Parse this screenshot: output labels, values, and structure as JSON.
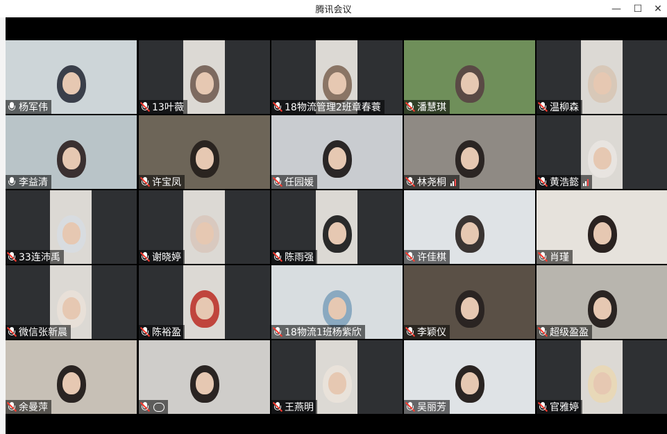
{
  "window": {
    "title": "腾讯会议",
    "controls": {
      "minimize": "—",
      "maximize": "☐",
      "close": "✕"
    }
  },
  "participants": [
    {
      "name": "杨军伟",
      "muted": false,
      "signal": false,
      "chat": false,
      "bg": "#cdd5d8",
      "person": "#3a3f4a"
    },
    {
      "name": "13叶薇",
      "muted": true,
      "signal": false,
      "chat": false,
      "bg": "#2e3033",
      "person": "#7d6a60"
    },
    {
      "name": "18物流管理2班章春蓑",
      "muted": true,
      "signal": false,
      "chat": false,
      "bg": "#2e3033",
      "person": "#8a7565"
    },
    {
      "name": "潘慧琪",
      "muted": true,
      "signal": false,
      "chat": false,
      "bg": "#6f8f5a",
      "person": "#5a4a45"
    },
    {
      "name": "温柳森",
      "muted": true,
      "signal": false,
      "chat": false,
      "bg": "#2e3033",
      "person": "#d8c8b8"
    },
    {
      "name": "李益清",
      "muted": false,
      "signal": false,
      "chat": false,
      "bg": "#b9c4c8",
      "person": "#3a3030"
    },
    {
      "name": "许宝凤",
      "muted": true,
      "signal": false,
      "chat": false,
      "bg": "#6d6558",
      "person": "#2a2420"
    },
    {
      "name": "任园媛",
      "muted": true,
      "signal": false,
      "chat": false,
      "bg": "#c9ccd0",
      "person": "#2a2626"
    },
    {
      "name": "林尧桐",
      "muted": true,
      "signal": true,
      "chat": false,
      "bg": "#8f8a84",
      "person": "#2b2523"
    },
    {
      "name": "黄浩懿",
      "muted": true,
      "signal": true,
      "chat": false,
      "bg": "#2e3033",
      "person": "#e8e4e0"
    },
    {
      "name": "33连沛禹",
      "muted": true,
      "signal": false,
      "chat": false,
      "bg": "#2e3033",
      "person": "#d8dce0"
    },
    {
      "name": "谢晓婷",
      "muted": true,
      "signal": false,
      "chat": false,
      "bg": "#2e3033",
      "person": "#d9c9bf"
    },
    {
      "name": "陈雨强",
      "muted": true,
      "signal": false,
      "chat": false,
      "bg": "#2e3033",
      "person": "#2a2a2a"
    },
    {
      "name": "许佳棋",
      "muted": true,
      "signal": false,
      "chat": false,
      "bg": "#dfe3e6",
      "person": "#3a3432"
    },
    {
      "name": "肖瑾",
      "muted": true,
      "signal": false,
      "chat": false,
      "bg": "#e6e2dc",
      "person": "#2a2220"
    },
    {
      "name": "微信张新晨",
      "muted": true,
      "signal": false,
      "chat": false,
      "bg": "#2e3033",
      "person": "#e8e0d8"
    },
    {
      "name": "陈裕盈",
      "muted": true,
      "signal": false,
      "chat": false,
      "bg": "#2e3033",
      "person": "#c0453d"
    },
    {
      "name": "18物流1班杨紫欣",
      "muted": true,
      "signal": false,
      "chat": false,
      "bg": "#d8dde0",
      "person": "#8aa9c0"
    },
    {
      "name": "李颖仪",
      "muted": true,
      "signal": false,
      "chat": false,
      "bg": "#5a5046",
      "person": "#2a2422"
    },
    {
      "name": "超级盈盈",
      "muted": true,
      "signal": false,
      "chat": false,
      "bg": "#b8b5ae",
      "person": "#2a2422"
    },
    {
      "name": "余曼萍",
      "muted": true,
      "signal": false,
      "chat": false,
      "bg": "#c7c0b6",
      "person": "#2a2422"
    },
    {
      "name": "",
      "muted": true,
      "signal": false,
      "chat": true,
      "bg": "#cfcdca",
      "person": "#2a2422"
    },
    {
      "name": "王燕明",
      "muted": true,
      "signal": false,
      "chat": false,
      "bg": "#2e3033",
      "person": "#e9e2da"
    },
    {
      "name": "吴丽芳",
      "muted": true,
      "signal": false,
      "chat": false,
      "bg": "#dfe3e6",
      "person": "#2a2422"
    },
    {
      "name": "官雅婷",
      "muted": true,
      "signal": false,
      "chat": false,
      "bg": "#2e3033",
      "person": "#e8d8b8"
    }
  ]
}
